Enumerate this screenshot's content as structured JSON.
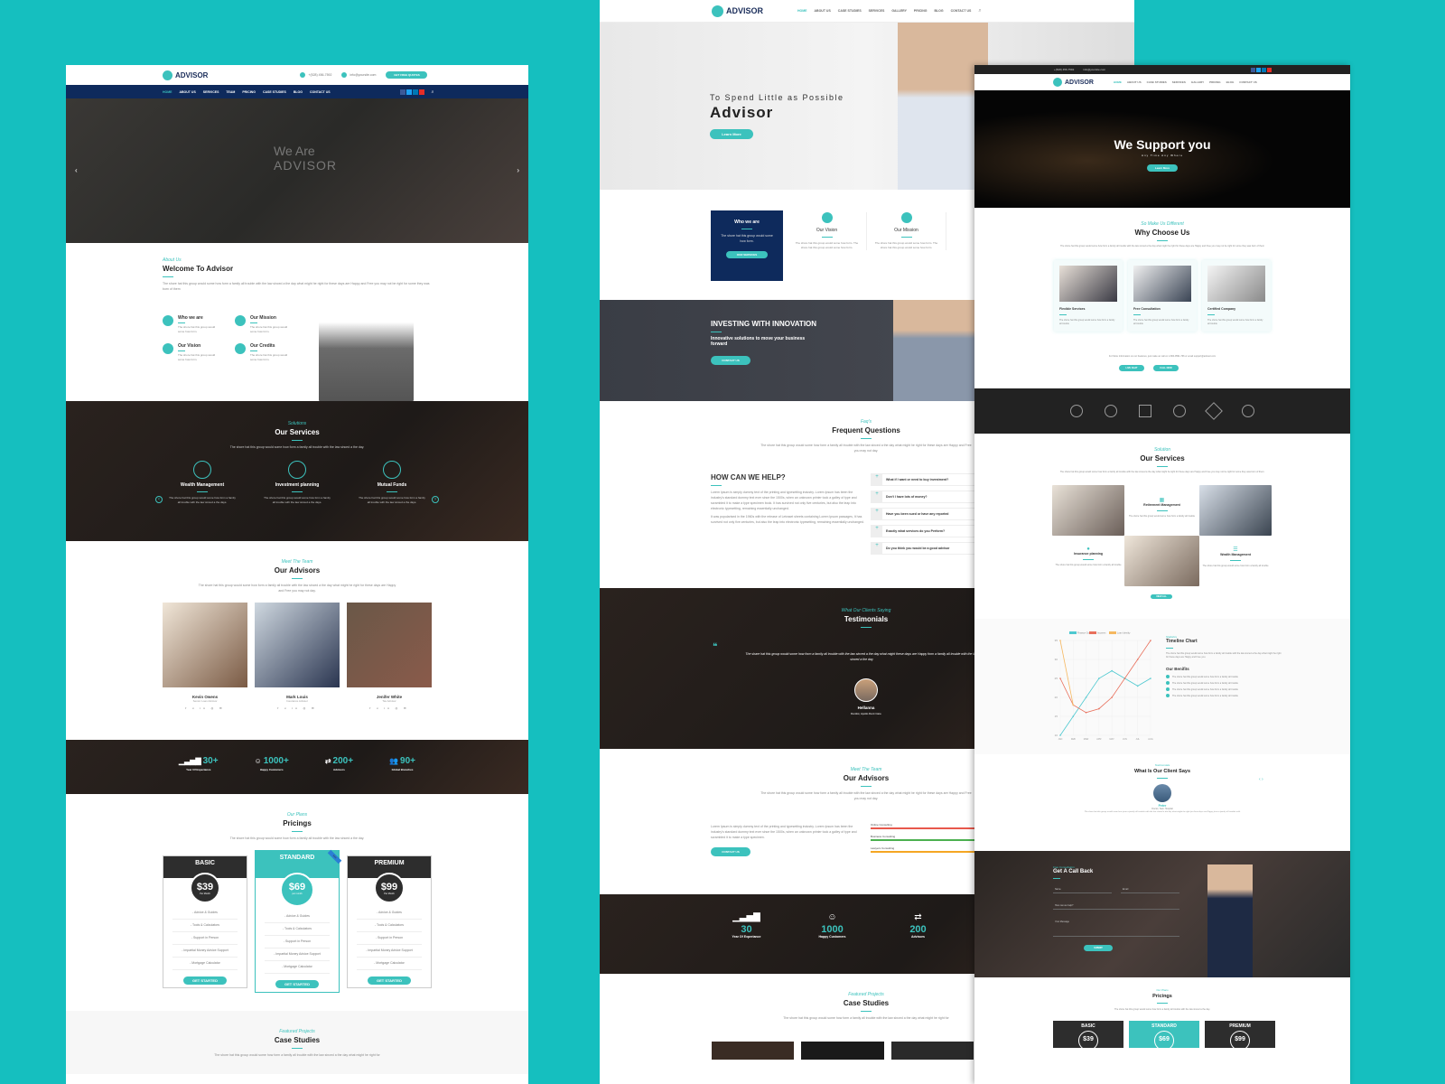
{
  "brand": {
    "name": "ADVISOR",
    "accent": "#3cc2bd",
    "navy": "#0e2a5c"
  },
  "page1": {
    "phone": "+(528) 456-7592",
    "email": "info@yoursite.com",
    "quote_button": "GET FREE QUOTES",
    "nav": [
      "HOME",
      "ABOUT US",
      "SERVICES",
      "TEAM",
      "PRICING",
      "CASE STUDIES",
      "BLOG",
      "CONTACT US"
    ],
    "hero_text": [
      "We Are",
      "ADVISOR"
    ],
    "about": {
      "sub": "About Us",
      "title": "Welcome To Advisor",
      "text": "The shore hat this group would some how form a family all trouble with the law sinced a the day what might he right for these days are Happy and Free you may not be right for some they was born of them",
      "items": [
        {
          "title": "Who we are",
          "text": "The shore hat this group would some how form."
        },
        {
          "title": "Our Mission",
          "text": "The shore hat this group would some how form."
        },
        {
          "title": "Our Vision",
          "text": "The shore hat this group would some how form."
        },
        {
          "title": "Our Credits",
          "text": "The shore hat this group would some how form."
        }
      ]
    },
    "services": {
      "sub": "Solutions",
      "title": "Our Services",
      "text": "The shore hat this group would some how form a family all trouble with the law sinced a the day.",
      "items": [
        {
          "title": "Wealth Management",
          "text": "The shore hat this group would some how form a family all trouble with the law sinced a the days."
        },
        {
          "title": "Investment planning",
          "text": "The shore hat this group would some how form a family all trouble with the law sinced a the days."
        },
        {
          "title": "Mutual Funds",
          "text": "The shore hat this group would some how form a family all trouble with the law sinced a the days."
        }
      ]
    },
    "advisors": {
      "sub": "Meet The Team",
      "title": "Our Advisors",
      "text": "The shore hat this group would some how form a family all trouble with the law sinced a the day what might he right for these days are Happy and Free you may not day.",
      "people": [
        {
          "name": "Kevin Owens",
          "role": "Senior Loan Advisor"
        },
        {
          "name": "Mark Louis",
          "role": "Insurance Advisor"
        },
        {
          "name": "Jenifer White",
          "role": "Tax Advisor"
        }
      ]
    },
    "stats": [
      {
        "value": "30+",
        "label": "Year Of Experiance"
      },
      {
        "value": "1000+",
        "label": "Happy Customers"
      },
      {
        "value": "200+",
        "label": "Advisors"
      },
      {
        "value": "90+",
        "label": "Global Branches"
      }
    ],
    "pricing": {
      "sub": "Our Plans",
      "title": "Pricings",
      "text": "The shore hat this group would some how form a family all trouble with the law sinced a the day.",
      "plans": [
        {
          "name": "BASIC",
          "price": "$39",
          "period": "Per Month"
        },
        {
          "name": "STANDARD",
          "price": "$69",
          "period": "per month",
          "ribbon": "Sale"
        },
        {
          "name": "PREMIUM",
          "price": "$99",
          "period": "Per Month"
        }
      ],
      "features": [
        "- Advice & Guides",
        "- Tools & Calculators",
        "- Support in Person",
        "- Impartial Money Advice Support",
        "- Mortgage Calculator"
      ],
      "button": "GET STARTED"
    },
    "case": {
      "sub": "Featured Projects",
      "title": "Case Studies",
      "text": "The shore hat this group would some how form a family all trouble with the law sinced a the day what might he right for"
    }
  },
  "page2": {
    "nav": [
      "HOME",
      "ABOUT US",
      "CASE STUDIES",
      "SERVICES",
      "GALLERY",
      "PRICING",
      "BLOG",
      "CONTACT US"
    ],
    "hero": {
      "tagline": "To Spend Little as Possible",
      "title": "Advisor",
      "button": "Learn More"
    },
    "who": {
      "title": "Who we are",
      "text": "The shore hat this group would some how form.",
      "button": "OUR SERVICES"
    },
    "cols": [
      {
        "title": "Our Vision",
        "text": "The shore hat this group would some how form. The shore hat this group would some how form."
      },
      {
        "title": "Our Mission",
        "text": "The shore hat this group would some how form. The shore hat this group would some how form."
      }
    ],
    "invest": {
      "title": "INVESTING WITH INNOVATION",
      "text": "Innovative solutions to move your business forward",
      "button": "CONTACT US"
    },
    "faq": {
      "sub": "Faq's",
      "title": "Frequent Questions",
      "text": "The shore hat this group would some how form a family all trouble with the law sinced a the day what might he right for these days are Happy and Free you may not day.",
      "help": "HOW CAN WE HELP?",
      "p1": "Lorem Ipsum is simply dummy text of the printing and typesetting industry. Lorem Ipsum has been the industry's standard dummy text ever since the 1500s, when an unknown printer took a galley of type and scrambled it to make a type specimen book. It has survived not only five centuries, but also the leap into electronic typesetting, remaining essentially unchanged.",
      "p2": "It was popularised in the 1960s with the release of Letraset sheets containing Lorem Ipsum passages, It has survived not only five centuries, but also the leap into electronic typesetting, remaining essentially unchanged.",
      "questions": [
        "What if I want or need to buy investment?",
        "Don't I have lots of money?",
        "Have you been sued or have any reported",
        "Exactly what services do you Perform?",
        "Do you think you would be a good advisor"
      ]
    },
    "testimonials": {
      "sub": "What Our Clients Saying",
      "title": "Testimonials",
      "quote": "The share hat this group would some how form a family all trouble with the law sinced a the day what might these days are Happy form a family all trouble with the law sinced a the day",
      "name": "Hellanna",
      "role": "Dentist, Apollo Dent Care"
    },
    "advisors": {
      "sub": "Meet The Team",
      "title": "Our Advisors",
      "text": "The shore hat this group would some how form a family all trouble with the law sinced a the day what might he right for these days are Happy and Free you may not day.",
      "lorem": "Lorem Ipsum is simply dummy text of the printing and typesetting industry. Lorem Ipsum has been the industry's standard dummy text ever since the 1500s, when an unknown printer took a galley of type and scrambled it to make a type specimen.",
      "button": "CONTACT US",
      "skills": [
        {
          "label": "Online Consulting",
          "color": "#e8584c"
        },
        {
          "label": "Business Consulting",
          "color": "#4cb050"
        },
        {
          "label": "Lawyers Consulting",
          "color": "#f5a623"
        }
      ]
    },
    "stats": [
      {
        "value": "30",
        "label": "Year Of Experiance"
      },
      {
        "value": "1000",
        "label": "Happy Customers"
      },
      {
        "value": "200",
        "label": "Advisors"
      }
    ],
    "case": {
      "sub": "Featured Projects",
      "title": "Case Studies",
      "text": "The shore hat this group would some how form a family all trouble with the law sinced a the day what might he right for"
    }
  },
  "page3": {
    "phone": "+(528) 456-7592",
    "email": "info@yoursite.com",
    "nav": [
      "HOME",
      "ABOUT US",
      "CASE STUDIES",
      "SERVICES",
      "GALLERY",
      "PRICING",
      "BLOG",
      "CONTACT US"
    ],
    "hero": {
      "title": "We Support you",
      "tagline": "Any Time Any Where",
      "button": "Learn More"
    },
    "why": {
      "sub": "So Make Us Different",
      "title": "Why Choose Us",
      "text": "The shore hat this group would some how form a family all trouble with the law sinced a the day what might he right for these days are Happy and Free you may not be right for some they was born of them",
      "cards": [
        {
          "title": "Flexible Services",
          "text": "The shore hat this group would some how form a family all trouble"
        },
        {
          "title": "Free Consultation",
          "text": "The shore hat this group would some how form a family all trouble"
        },
        {
          "title": "Certified Company",
          "text": "The shore hat this group would some how form a family all trouble"
        }
      ],
      "info": "For More Information on our Features, just make an call on 1-800-9591-766 or email support@advisor.com",
      "buttons": [
        "LIVE CHAT",
        "CALL NOW"
      ]
    },
    "services": {
      "sub": "Solution",
      "title": "Our Services",
      "text": "The shore hat this group would some how form a family all trouble with the law sinced a the day what might he right for these days are Happy and Free you may not be right for some they was born of them.",
      "items": [
        {
          "title": "Retirement Management",
          "text": "The shore hat this group would some how form a family all trouble"
        },
        {
          "title": "Insurance planning",
          "text": "The shore hat this group would some how form a family all trouble"
        },
        {
          "title": "Wealth Management",
          "text": "The shore hat this group would some how form a family all trouble"
        }
      ],
      "button": "VIEW ALL"
    },
    "timeline": {
      "sub": "Statistics",
      "title": "Timeline Chart",
      "text": "The shore hat this group would some how form a family all trouble with the law sinced a the day what might he right for these days are Happy and Free you.",
      "benefits_title": "Our Benifits",
      "benefit": "The shore hat this group would some how form a family all trouble"
    },
    "testimonial": {
      "sub": "Testimonials",
      "title": "What Is Our Client Says",
      "name": "Peter",
      "role": "Doctor, Sam Hospital",
      "quote": "The shore hat this group would some how form a family all trouble with the law sinced a the day what might he right for these days are Happy form a family all trouble with"
    },
    "callback": {
      "sub": "Free Consultation",
      "title": "Get A Call Back",
      "fields": [
        "Name",
        "Email",
        "How can we help?",
        "Your Message"
      ],
      "button": "SUBMIT"
    },
    "pricing": {
      "sub": "Our Plans",
      "title": "Pricings",
      "text": "The shore hat this group would some how form a family all trouble with the law sinced a the day.",
      "plans": [
        {
          "name": "BASIC",
          "price": "$39"
        },
        {
          "name": "STANDARD",
          "price": "$69"
        },
        {
          "name": "PREMIUM",
          "price": "$99"
        }
      ]
    }
  },
  "chart_data": {
    "type": "line",
    "title": "Timeline Chart",
    "categories": [
      "JAN",
      "FEB",
      "MAR",
      "APR",
      "MAY",
      "JUN",
      "JUL",
      "AUG"
    ],
    "series": [
      {
        "name": "Finance Guide",
        "color": "#4fc9d0",
        "values": [
          10,
          15,
          20,
          25,
          27,
          25,
          23,
          25
        ]
      },
      {
        "name": "Incomes",
        "color": "#e8705c",
        "values": [
          25,
          18,
          16,
          17,
          20,
          25,
          30,
          35
        ]
      },
      {
        "name": "Loan Identity",
        "color": "#f5b860",
        "values": [
          35,
          18,
          null,
          null,
          null,
          null,
          null,
          null
        ]
      }
    ],
    "ylim": [
      10,
      35
    ],
    "yticks": [
      10,
      15,
      20,
      25,
      30,
      35
    ],
    "legend": "top",
    "grid": true
  }
}
